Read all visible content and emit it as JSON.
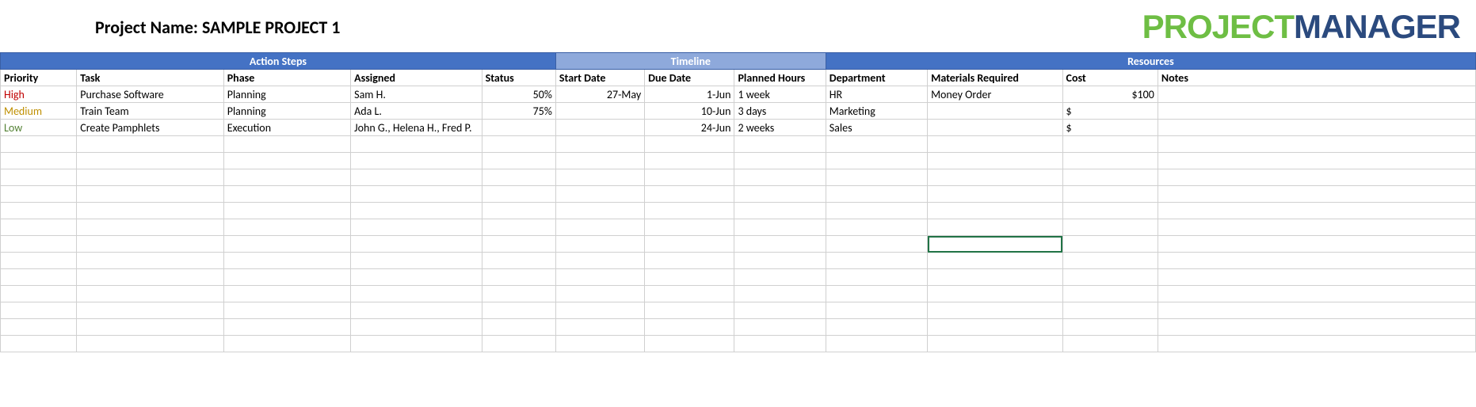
{
  "header": {
    "project_label": "Project Name: SAMPLE PROJECT 1",
    "logo_part1": "PROJECT",
    "logo_part2": "MANAGER"
  },
  "sections": {
    "action_steps": "Action Steps",
    "timeline": "Timeline",
    "resources": "Resources"
  },
  "columns": {
    "priority": "Priority",
    "task": "Task",
    "phase": "Phase",
    "assigned": "Assigned",
    "status": "Status",
    "start_date": "Start Date",
    "due_date": "Due Date",
    "planned_hours": "Planned Hours",
    "department": "Department",
    "materials": "Materials Required",
    "cost": "Cost",
    "notes": "Notes"
  },
  "rows": [
    {
      "priority": "High",
      "priority_class": "priority-high",
      "task": "Purchase Software",
      "phase": "Planning",
      "assigned": "Sam H.",
      "status": "50%",
      "start_date": "27-May",
      "due_date": "1-Jun",
      "planned_hours": "1 week",
      "department": "HR",
      "materials": "Money Order",
      "cost": "$100",
      "notes": ""
    },
    {
      "priority": "Medium",
      "priority_class": "priority-medium",
      "task": "Train Team",
      "phase": "Planning",
      "assigned": "Ada L.",
      "status": "75%",
      "start_date": "",
      "due_date": "10-Jun",
      "planned_hours": "3 days",
      "department": "Marketing",
      "materials": "",
      "cost": "$",
      "notes": ""
    },
    {
      "priority": "Low",
      "priority_class": "priority-low",
      "task": "Create Pamphlets",
      "phase": "Execution",
      "assigned": "John G., Helena H., Fred P.",
      "status": "",
      "start_date": "",
      "due_date": "24-Jun",
      "planned_hours": "2 weeks",
      "department": "Sales",
      "materials": "",
      "cost": "$",
      "notes": ""
    }
  ],
  "empty_rows": 13,
  "selected_cell": {
    "row_index": 9,
    "col_index": 9
  }
}
